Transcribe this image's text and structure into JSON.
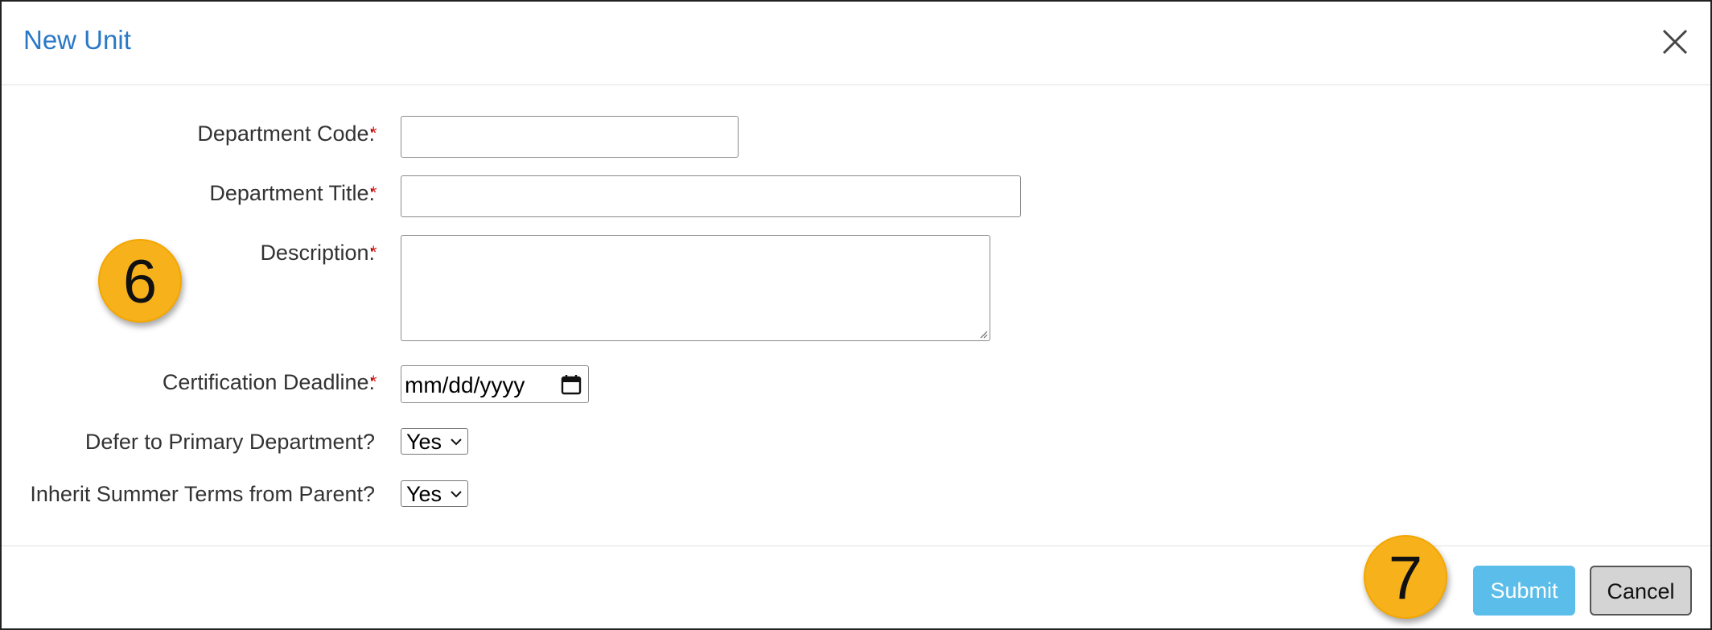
{
  "dialog": {
    "title": "New Unit",
    "close_icon": "close-icon"
  },
  "form": {
    "required_marker": "*",
    "department_code": {
      "label": "Department Code:",
      "value": ""
    },
    "department_title": {
      "label": "Department Title:",
      "value": ""
    },
    "description": {
      "label": "Description:",
      "value": ""
    },
    "certification_deadline": {
      "label": "Certification Deadline:",
      "placeholder": "mm/dd/yyyy",
      "icon": "calendar-icon"
    },
    "defer_primary": {
      "label": "Defer to Primary Department?",
      "selected": "Yes",
      "icon": "chevron-down-icon"
    },
    "inherit_summer": {
      "label": "Inherit Summer Terms from Parent?",
      "selected": "Yes",
      "icon": "chevron-down-icon"
    }
  },
  "markers": {
    "step_6": "6",
    "step_7": "7",
    "color": "#f7b21b"
  },
  "footer": {
    "submit_label": "Submit",
    "cancel_label": "Cancel"
  },
  "colors": {
    "title": "#2a78c6",
    "required": "#e02020",
    "submit_bg": "#5bbde9",
    "cancel_bg": "#d4d4d4"
  }
}
